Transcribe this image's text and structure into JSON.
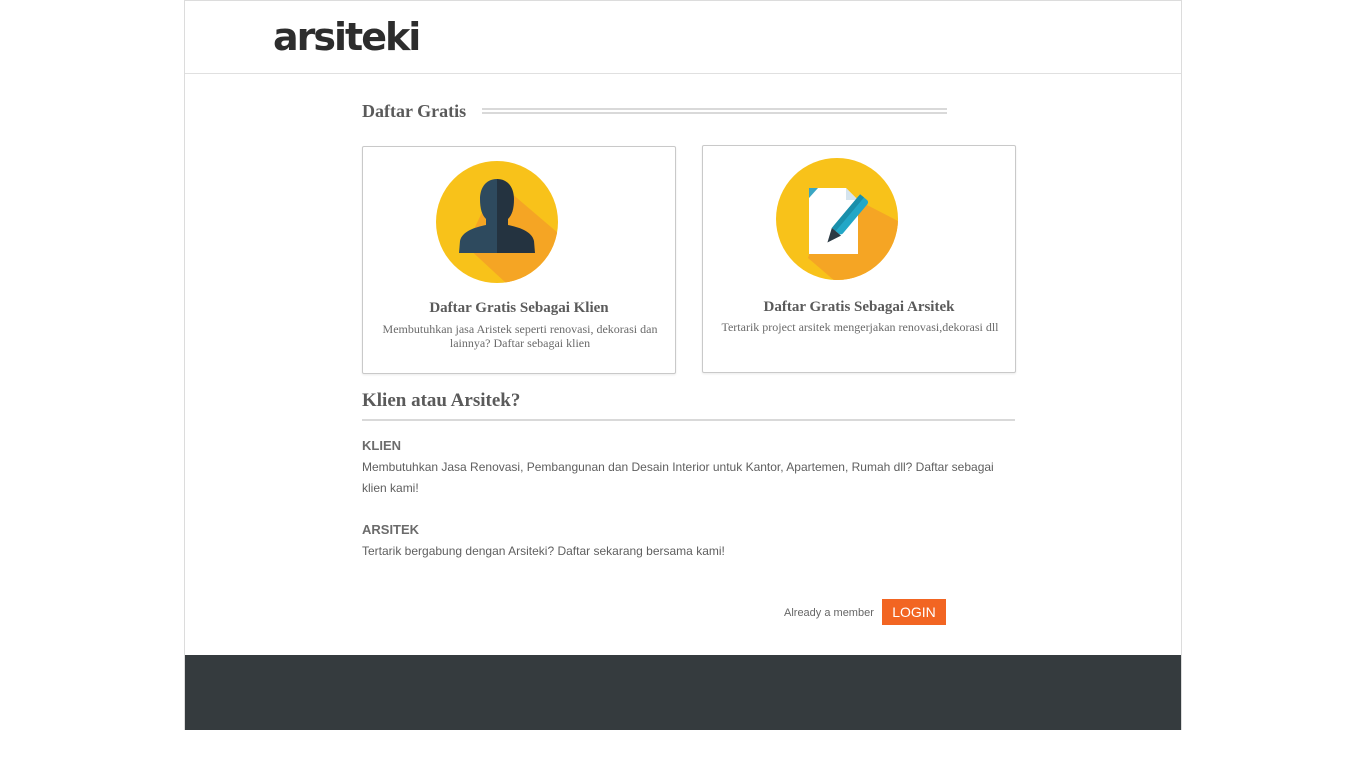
{
  "brand": {
    "logo_text": "arsiteki"
  },
  "colors": {
    "accent_orange": "#f26522",
    "icon_yellow": "#f8c21a",
    "footer_bg": "#353b3e"
  },
  "register": {
    "title": "Daftar Gratis",
    "cards": [
      {
        "icon": "user-silhouette-icon",
        "title": "Daftar Gratis Sebagai Klien",
        "desc": "Membutuhkan jasa Aristek seperti renovasi, dekorasi dan lainnya? Daftar sebagai klien"
      },
      {
        "icon": "document-pen-icon",
        "title": "Daftar Gratis Sebagai Arsitek",
        "desc": "Tertarik project arsitek mengerjakan renovasi,dekorasi dll"
      }
    ]
  },
  "info": {
    "title": "Klien atau Arsitek?",
    "klien_head": "KLIEN",
    "klien_text": "Membutuhkan Jasa Renovasi, Pembangunan dan Desain Interior untuk Kantor, Apartemen, Rumah dll? Daftar sebagai klien kami!",
    "arsitek_head": "ARSITEK",
    "arsitek_text": "Tertarik bergabung dengan Arsiteki? Daftar sekarang bersama kami!"
  },
  "login": {
    "prompt": "Already a member",
    "button": "LOGIN"
  }
}
